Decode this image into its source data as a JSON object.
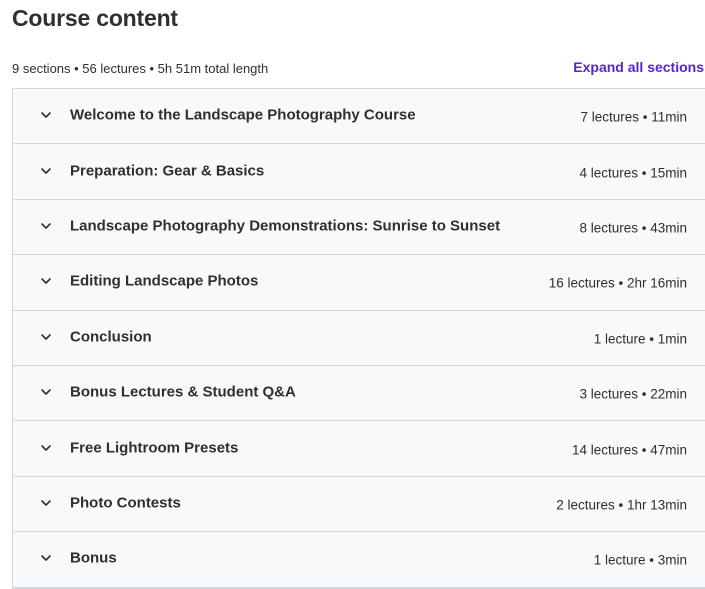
{
  "header": {
    "title": "Course content",
    "summary": "9 sections • 56 lectures • 5h 51m total length",
    "expand_all_label": "Expand all sections"
  },
  "icons": {
    "section_toggle": "chevron-down-icon"
  },
  "colors": {
    "accent": "#5624d0",
    "section_bg": "#f7f9fa",
    "border": "#d1d7dc",
    "text": "#2d2f31"
  },
  "sections": [
    {
      "title": "Welcome to the Landscape Photography Course",
      "meta": "7 lectures • 11min"
    },
    {
      "title": "Preparation: Gear & Basics",
      "meta": "4 lectures • 15min"
    },
    {
      "title": "Landscape Photography Demonstrations: Sunrise to Sunset",
      "meta": "8 lectures • 43min"
    },
    {
      "title": "Editing Landscape Photos",
      "meta": "16 lectures • 2hr 16min"
    },
    {
      "title": "Conclusion",
      "meta": "1 lecture • 1min"
    },
    {
      "title": "Bonus Lectures & Student Q&A",
      "meta": "3 lectures • 22min"
    },
    {
      "title": "Free Lightroom Presets",
      "meta": "14 lectures • 47min"
    },
    {
      "title": "Photo Contests",
      "meta": "2 lectures • 1hr 13min"
    },
    {
      "title": "Bonus",
      "meta": "1 lecture • 3min"
    }
  ]
}
